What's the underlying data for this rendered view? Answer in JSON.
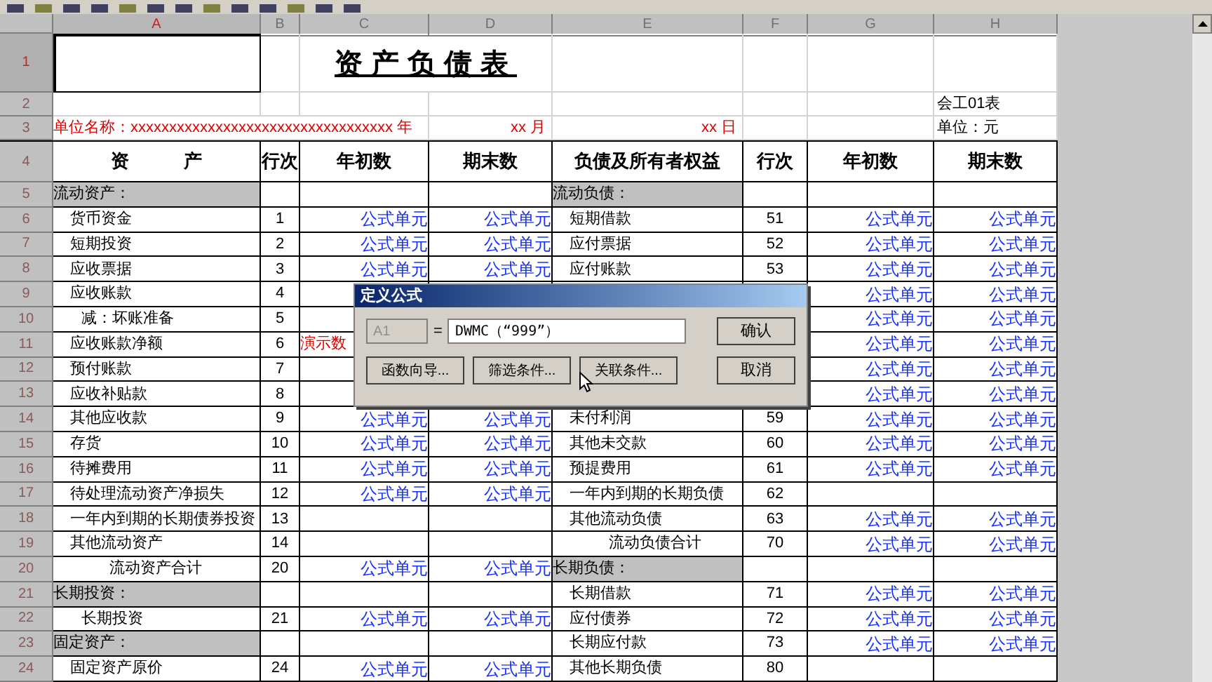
{
  "columns": [
    {
      "label": "A",
      "selected": true
    },
    {
      "label": "B",
      "selected": false
    },
    {
      "label": "C",
      "selected": false
    },
    {
      "label": "D",
      "selected": false
    },
    {
      "label": "E",
      "selected": false
    },
    {
      "label": "F",
      "selected": false
    },
    {
      "label": "G",
      "selected": false
    },
    {
      "label": "H",
      "selected": false
    }
  ],
  "rows": [
    {
      "num": "1",
      "kind": "title",
      "selected": true,
      "cells": [
        {
          "kind": "blank"
        },
        {
          "kind": "blank"
        },
        {
          "kind": "title",
          "text": "资产负债表"
        },
        {
          "kind": "blank"
        },
        {
          "kind": "blank"
        },
        {
          "kind": "blank"
        },
        {
          "kind": "blank"
        }
      ]
    },
    {
      "num": "2",
      "kind": "info",
      "selected": false,
      "cells": [
        {
          "kind": "blank"
        },
        {
          "kind": "blank"
        },
        {
          "kind": "blank"
        },
        {
          "kind": "blank"
        },
        {
          "kind": "blank"
        },
        {
          "kind": "blank"
        },
        {
          "kind": "blank"
        },
        {
          "kind": "text",
          "text": "会工01表"
        }
      ]
    },
    {
      "num": "3",
      "kind": "info",
      "selected": false,
      "cells": [
        {
          "kind": "red_wide",
          "text": "单位名称：xxxxxxxxxxxxxxxxxxxxxxxxxxxxxxxxxx 年"
        },
        {
          "kind": "red_right",
          "text": "xx 月"
        },
        {
          "kind": "red_right",
          "text": "xx 日"
        },
        {
          "kind": "blank"
        },
        {
          "kind": "blank"
        },
        {
          "kind": "text",
          "text": "单位：元"
        }
      ]
    },
    {
      "num": "4",
      "kind": "header",
      "selected": false,
      "cells": [
        {
          "kind": "head",
          "text": "资　　　产"
        },
        {
          "kind": "head",
          "text": "行次"
        },
        {
          "kind": "head",
          "text": "年初数"
        },
        {
          "kind": "head",
          "text": "期末数"
        },
        {
          "kind": "head",
          "text": "负债及所有者权益"
        },
        {
          "kind": "head",
          "text": "行次"
        },
        {
          "kind": "head",
          "text": "年初数"
        },
        {
          "kind": "head",
          "text": "期末数"
        }
      ]
    },
    {
      "num": "5",
      "kind": "body",
      "selected": false,
      "cells": [
        {
          "kind": "section",
          "text": "流动资产："
        },
        {
          "kind": "blank"
        },
        {
          "kind": "blank"
        },
        {
          "kind": "blank"
        },
        {
          "kind": "section",
          "text": "流动负债："
        },
        {
          "kind": "blank"
        },
        {
          "kind": "blank"
        },
        {
          "kind": "blank"
        }
      ]
    },
    {
      "num": "6",
      "kind": "body",
      "selected": false,
      "cells": [
        {
          "kind": "item",
          "text": "货币资金"
        },
        {
          "kind": "num",
          "text": "1"
        },
        {
          "kind": "formula",
          "text": "公式单元"
        },
        {
          "kind": "formula",
          "text": "公式单元"
        },
        {
          "kind": "item",
          "text": "短期借款"
        },
        {
          "kind": "num",
          "text": "51"
        },
        {
          "kind": "formula",
          "text": "公式单元"
        },
        {
          "kind": "formula",
          "text": "公式单元"
        }
      ]
    },
    {
      "num": "7",
      "kind": "body",
      "selected": false,
      "cells": [
        {
          "kind": "item",
          "text": "短期投资"
        },
        {
          "kind": "num",
          "text": "2"
        },
        {
          "kind": "formula",
          "text": "公式单元"
        },
        {
          "kind": "formula",
          "text": "公式单元"
        },
        {
          "kind": "item",
          "text": "应付票据"
        },
        {
          "kind": "num",
          "text": "52"
        },
        {
          "kind": "formula",
          "text": "公式单元"
        },
        {
          "kind": "formula",
          "text": "公式单元"
        }
      ]
    },
    {
      "num": "8",
      "kind": "body",
      "selected": false,
      "cells": [
        {
          "kind": "item",
          "text": "应收票据"
        },
        {
          "kind": "num",
          "text": "3"
        },
        {
          "kind": "formula",
          "text": "公式单元"
        },
        {
          "kind": "formula",
          "text": "公式单元"
        },
        {
          "kind": "item",
          "text": "应付账款"
        },
        {
          "kind": "num",
          "text": "53"
        },
        {
          "kind": "formula",
          "text": "公式单元"
        },
        {
          "kind": "formula",
          "text": "公式单元"
        }
      ]
    },
    {
      "num": "9",
      "kind": "body",
      "selected": false,
      "cells": [
        {
          "kind": "item",
          "text": "应收账款"
        },
        {
          "kind": "num",
          "text": "4"
        },
        {
          "kind": "blank"
        },
        {
          "kind": "blank"
        },
        {
          "kind": "blank"
        },
        {
          "kind": "blank"
        },
        {
          "kind": "formula",
          "text": "公式单元"
        },
        {
          "kind": "formula",
          "text": "公式单元"
        }
      ]
    },
    {
      "num": "10",
      "kind": "body",
      "selected": false,
      "cells": [
        {
          "kind": "subitem",
          "text": "减：坏账准备"
        },
        {
          "kind": "num",
          "text": "5"
        },
        {
          "kind": "blank"
        },
        {
          "kind": "covered"
        },
        {
          "kind": "covered"
        },
        {
          "kind": "covered"
        },
        {
          "kind": "formula",
          "text": "公式单元"
        },
        {
          "kind": "formula",
          "text": "公式单元"
        }
      ]
    },
    {
      "num": "11",
      "kind": "body",
      "selected": false,
      "cells": [
        {
          "kind": "item",
          "text": "应收账款净额"
        },
        {
          "kind": "num",
          "text": "6"
        },
        {
          "kind": "red",
          "text": "演示数"
        },
        {
          "kind": "covered"
        },
        {
          "kind": "blank"
        },
        {
          "kind": "blank"
        },
        {
          "kind": "formula",
          "text": "公式单元"
        },
        {
          "kind": "formula",
          "text": "公式单元"
        }
      ]
    },
    {
      "num": "12",
      "kind": "body",
      "selected": false,
      "cells": [
        {
          "kind": "item",
          "text": "预付账款"
        },
        {
          "kind": "num",
          "text": "7"
        },
        {
          "kind": "blank"
        },
        {
          "kind": "blank"
        },
        {
          "kind": "blank"
        },
        {
          "kind": "blank"
        },
        {
          "kind": "formula",
          "text": "公式单元"
        },
        {
          "kind": "formula",
          "text": "公式单元"
        }
      ]
    },
    {
      "num": "13",
      "kind": "body",
      "selected": false,
      "cells": [
        {
          "kind": "item",
          "text": "应收补贴款"
        },
        {
          "kind": "num",
          "text": "8"
        },
        {
          "kind": "blank"
        },
        {
          "kind": "blank"
        },
        {
          "kind": "blank"
        },
        {
          "kind": "blank"
        },
        {
          "kind": "formula",
          "text": "公式单元"
        },
        {
          "kind": "formula",
          "text": "公式单元"
        }
      ]
    },
    {
      "num": "14",
      "kind": "body",
      "selected": false,
      "cells": [
        {
          "kind": "item",
          "text": "其他应收款"
        },
        {
          "kind": "num",
          "text": "9"
        },
        {
          "kind": "formula",
          "text": "公式单元"
        },
        {
          "kind": "formula",
          "text": "公式单元"
        },
        {
          "kind": "item",
          "text": "未付利润"
        },
        {
          "kind": "num",
          "text": "59"
        },
        {
          "kind": "formula",
          "text": "公式单元"
        },
        {
          "kind": "formula",
          "text": "公式单元"
        }
      ]
    },
    {
      "num": "15",
      "kind": "body",
      "selected": false,
      "cells": [
        {
          "kind": "item",
          "text": "存货"
        },
        {
          "kind": "num",
          "text": "10"
        },
        {
          "kind": "formula",
          "text": "公式单元"
        },
        {
          "kind": "formula",
          "text": "公式单元"
        },
        {
          "kind": "item",
          "text": "其他未交款"
        },
        {
          "kind": "num",
          "text": "60"
        },
        {
          "kind": "formula",
          "text": "公式单元"
        },
        {
          "kind": "formula",
          "text": "公式单元"
        }
      ]
    },
    {
      "num": "16",
      "kind": "body",
      "selected": false,
      "cells": [
        {
          "kind": "item",
          "text": "待摊费用"
        },
        {
          "kind": "num",
          "text": "11"
        },
        {
          "kind": "formula",
          "text": "公式单元"
        },
        {
          "kind": "formula",
          "text": "公式单元"
        },
        {
          "kind": "item",
          "text": "预提费用"
        },
        {
          "kind": "num",
          "text": "61"
        },
        {
          "kind": "formula",
          "text": "公式单元"
        },
        {
          "kind": "formula",
          "text": "公式单元"
        }
      ]
    },
    {
      "num": "17",
      "kind": "body",
      "selected": false,
      "cells": [
        {
          "kind": "item",
          "text": "待处理流动资产净损失"
        },
        {
          "kind": "num",
          "text": "12"
        },
        {
          "kind": "formula",
          "text": "公式单元"
        },
        {
          "kind": "formula",
          "text": "公式单元"
        },
        {
          "kind": "item",
          "text": "一年内到期的长期负债"
        },
        {
          "kind": "num",
          "text": "62"
        },
        {
          "kind": "blank"
        },
        {
          "kind": "blank"
        }
      ]
    },
    {
      "num": "18",
      "kind": "body",
      "selected": false,
      "cells": [
        {
          "kind": "item",
          "text": "一年内到期的长期债券投资"
        },
        {
          "kind": "num",
          "text": "13"
        },
        {
          "kind": "blank"
        },
        {
          "kind": "blank"
        },
        {
          "kind": "item",
          "text": "其他流动负债"
        },
        {
          "kind": "num",
          "text": "63"
        },
        {
          "kind": "formula",
          "text": "公式单元"
        },
        {
          "kind": "formula",
          "text": "公式单元"
        }
      ]
    },
    {
      "num": "19",
      "kind": "body",
      "selected": false,
      "cells": [
        {
          "kind": "item",
          "text": "其他流动资产"
        },
        {
          "kind": "num",
          "text": "14"
        },
        {
          "kind": "blank"
        },
        {
          "kind": "blank"
        },
        {
          "kind": "total",
          "text": "流动负债合计"
        },
        {
          "kind": "num",
          "text": "70"
        },
        {
          "kind": "formula",
          "text": "公式单元"
        },
        {
          "kind": "formula",
          "text": "公式单元"
        }
      ]
    },
    {
      "num": "20",
      "kind": "body",
      "selected": false,
      "cells": [
        {
          "kind": "total",
          "text": "流动资产合计"
        },
        {
          "kind": "num",
          "text": "20"
        },
        {
          "kind": "formula",
          "text": "公式单元"
        },
        {
          "kind": "formula",
          "text": "公式单元"
        },
        {
          "kind": "section",
          "text": "长期负债："
        },
        {
          "kind": "blank"
        },
        {
          "kind": "blank"
        },
        {
          "kind": "blank"
        }
      ]
    },
    {
      "num": "21",
      "kind": "body",
      "selected": false,
      "cells": [
        {
          "kind": "section",
          "text": "长期投资："
        },
        {
          "kind": "blank"
        },
        {
          "kind": "blank"
        },
        {
          "kind": "blank"
        },
        {
          "kind": "item",
          "text": "长期借款"
        },
        {
          "kind": "num",
          "text": "71"
        },
        {
          "kind": "formula",
          "text": "公式单元"
        },
        {
          "kind": "formula",
          "text": "公式单元"
        }
      ]
    },
    {
      "num": "22",
      "kind": "body",
      "selected": false,
      "cells": [
        {
          "kind": "subitem",
          "text": "长期投资"
        },
        {
          "kind": "num",
          "text": "21"
        },
        {
          "kind": "formula",
          "text": "公式单元"
        },
        {
          "kind": "formula",
          "text": "公式单元"
        },
        {
          "kind": "item",
          "text": "应付债券"
        },
        {
          "kind": "num",
          "text": "72"
        },
        {
          "kind": "formula",
          "text": "公式单元"
        },
        {
          "kind": "formula",
          "text": "公式单元"
        }
      ]
    },
    {
      "num": "23",
      "kind": "body",
      "selected": false,
      "cells": [
        {
          "kind": "section",
          "text": "固定资产："
        },
        {
          "kind": "blank"
        },
        {
          "kind": "blank"
        },
        {
          "kind": "blank"
        },
        {
          "kind": "item",
          "text": "长期应付款"
        },
        {
          "kind": "num",
          "text": "73"
        },
        {
          "kind": "formula",
          "text": "公式单元"
        },
        {
          "kind": "formula",
          "text": "公式单元"
        }
      ]
    },
    {
      "num": "24",
      "kind": "body",
      "selected": false,
      "cells": [
        {
          "kind": "item",
          "text": "固定资产原价"
        },
        {
          "kind": "num",
          "text": "24"
        },
        {
          "kind": "formula",
          "text": "公式单元"
        },
        {
          "kind": "formula",
          "text": "公式单元"
        },
        {
          "kind": "item",
          "text": "其他长期负债"
        },
        {
          "kind": "num",
          "text": "80"
        },
        {
          "kind": "blank"
        },
        {
          "kind": "blank"
        }
      ]
    }
  ],
  "dialog": {
    "title": "定义公式",
    "cell_ref": "A1",
    "equals": "=",
    "formula": "DWMC（“999”）",
    "buttons": [
      {
        "label": "函数向导..."
      },
      {
        "label": "筛选条件..."
      },
      {
        "label": "关联条件..."
      }
    ],
    "ok": "确认",
    "cancel": "取消"
  }
}
